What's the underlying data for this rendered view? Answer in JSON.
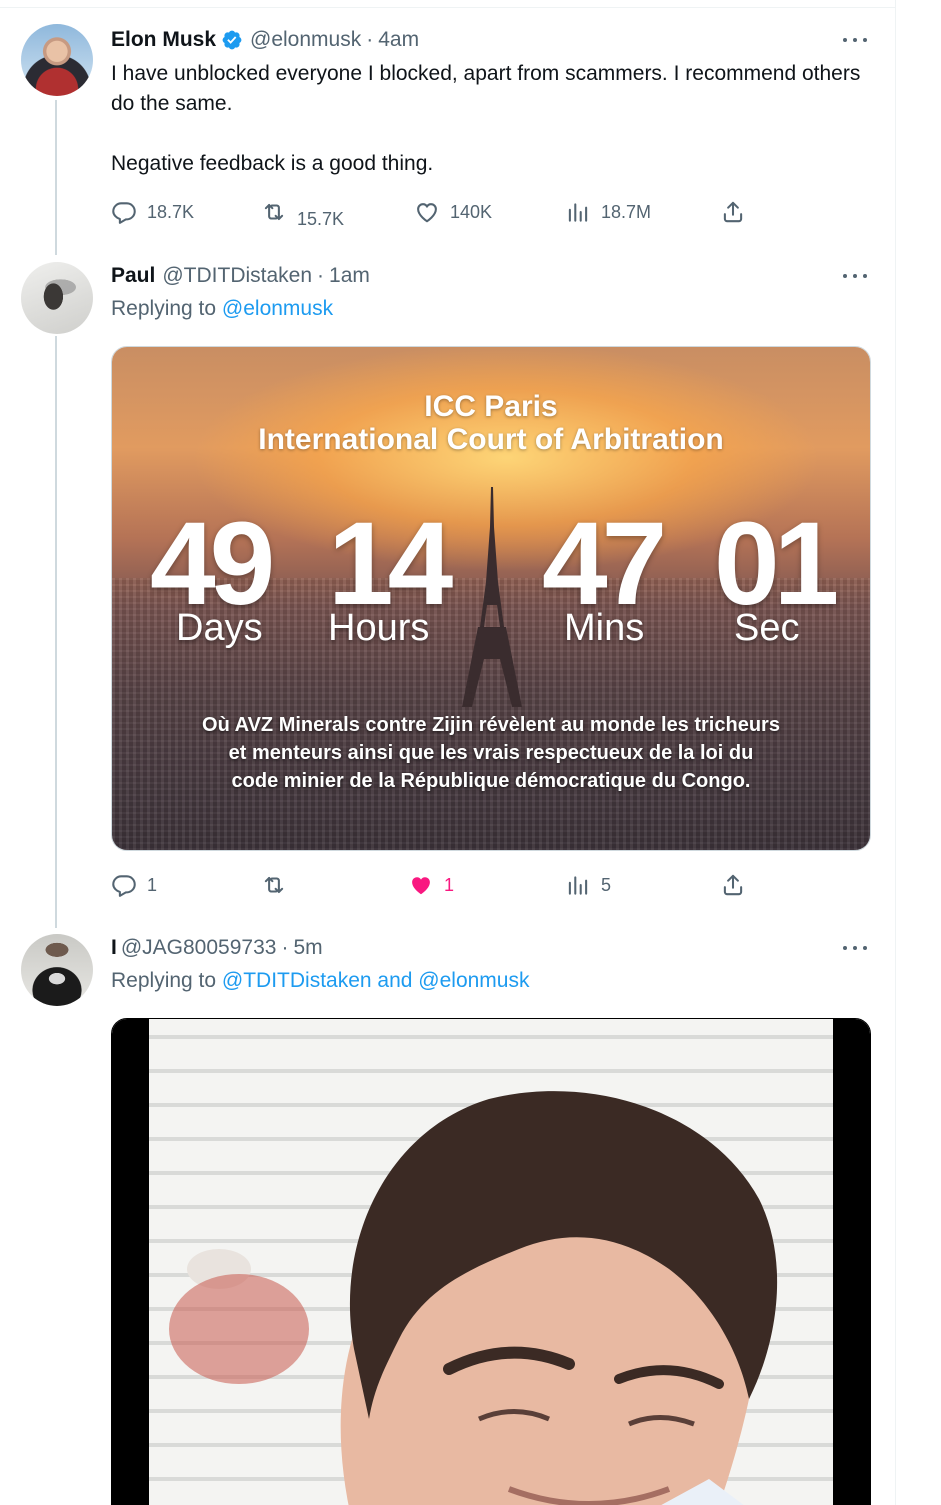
{
  "colors": {
    "link": "#1d9bf0",
    "secondary_text": "#536471",
    "like_active": "#f91880",
    "verified": "#1d9bf0"
  },
  "tweets": [
    {
      "name": "Elon Musk",
      "verified": true,
      "handle": "@elonmusk",
      "separator": "·",
      "time": "4am",
      "text_lines": [
        "I have unblocked everyone I blocked, apart from scammers. I recommend others do the same.",
        "Negative feedback is a good thing."
      ],
      "actions": {
        "replies": "18.7K",
        "reposts": "15.7K",
        "likes": "140K",
        "views": "18.7M"
      }
    },
    {
      "name": "Paul",
      "handle": "@TDITDistaken",
      "separator": "·",
      "time": "1am",
      "reply_prefix": "Replying to",
      "reply_mentions": "@elonmusk",
      "media": {
        "title_line1": "ICC Paris",
        "title_line2": "International Court of Arbitration",
        "countdown": [
          {
            "value": "49",
            "unit": "Days"
          },
          {
            "value": "14",
            "unit": "Hours"
          },
          {
            "value": "47",
            "unit": "Mins"
          },
          {
            "value": "01",
            "unit": "Sec"
          }
        ],
        "caption_lines": [
          "Où AVZ Minerals contre Zijin révèlent au monde les tricheurs",
          "et menteurs ainsi que les vrais respectueux de la loi du",
          "code minier de la République démocratique du Congo."
        ]
      },
      "actions": {
        "replies": "1",
        "reposts": "",
        "likes": "1",
        "liked": true,
        "views": "5"
      }
    },
    {
      "name": "I",
      "handle": "@JAG80059733",
      "separator": "·",
      "time": "5m",
      "reply_prefix": "Replying to",
      "reply_mentions": "@TDITDistaken and @elonmusk"
    }
  ]
}
